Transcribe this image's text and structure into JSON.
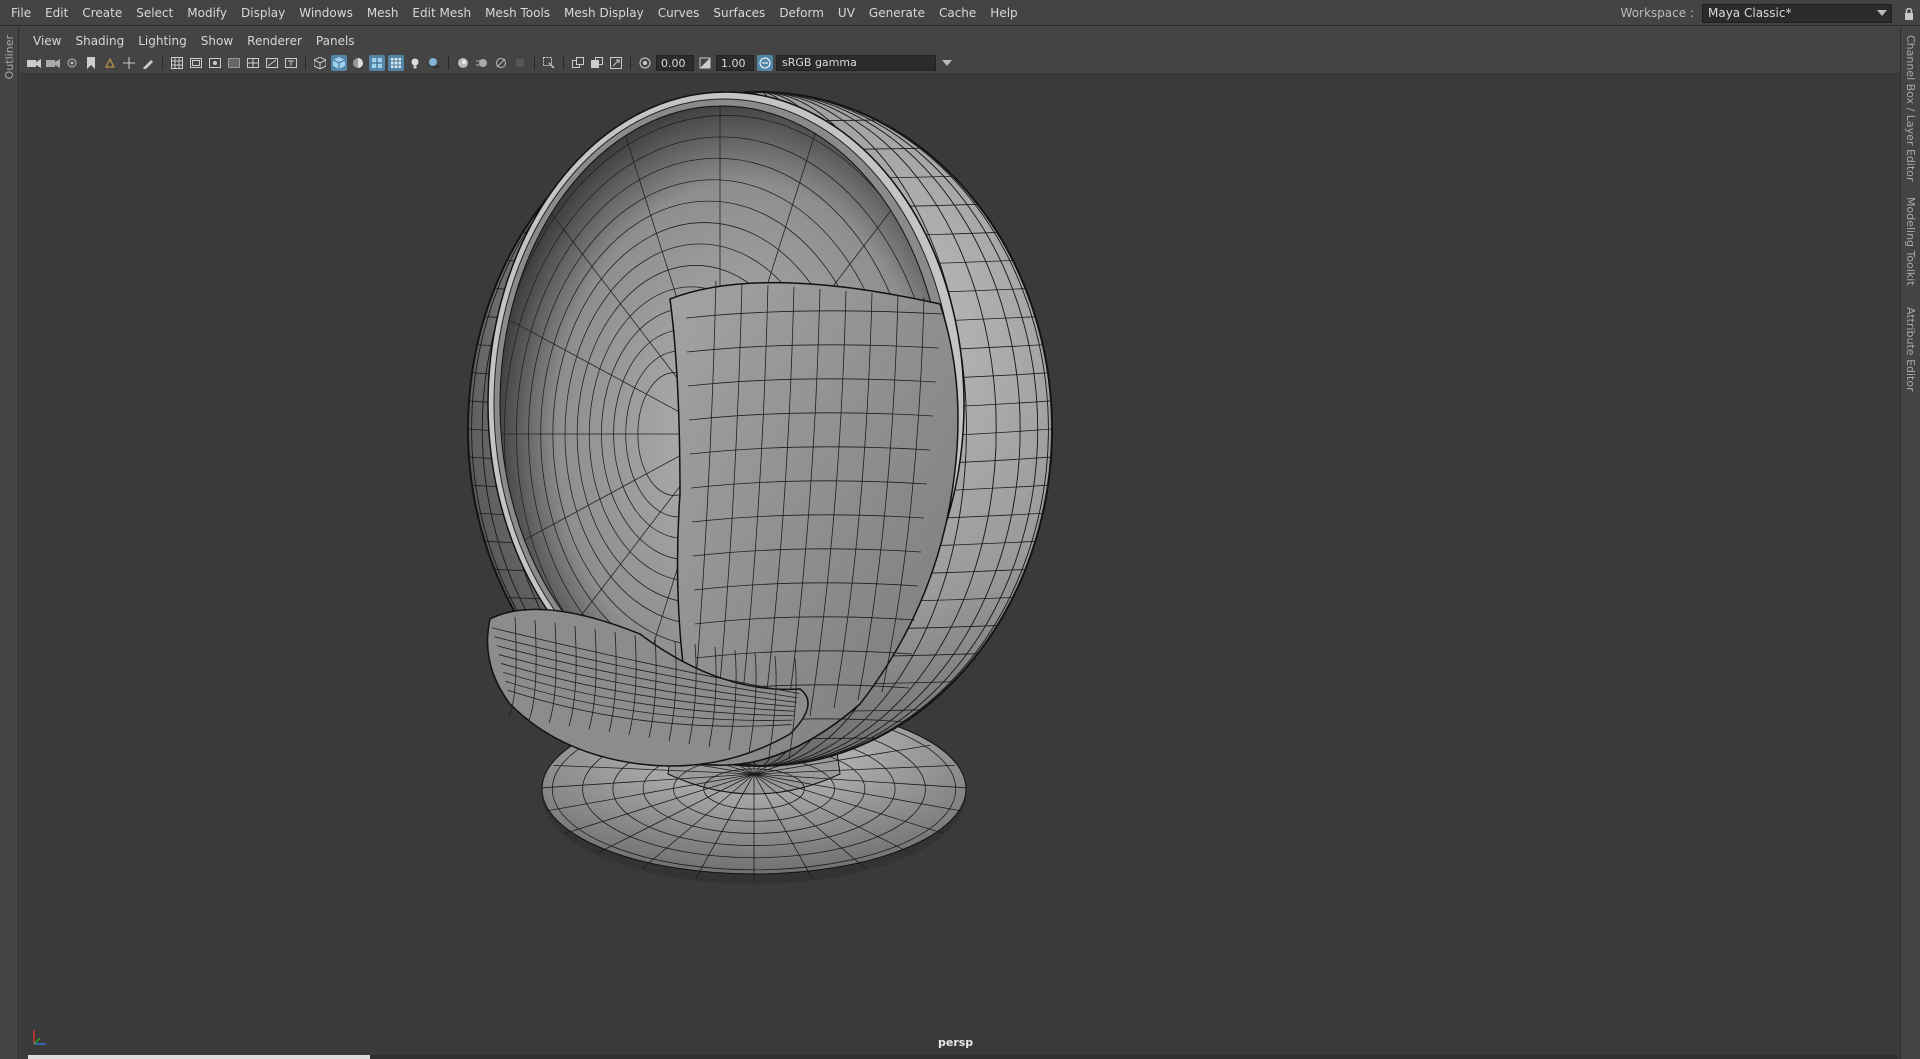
{
  "menubar": {
    "items": [
      "File",
      "Edit",
      "Create",
      "Select",
      "Modify",
      "Display",
      "Windows",
      "Mesh",
      "Edit Mesh",
      "Mesh Tools",
      "Mesh Display",
      "Curves",
      "Surfaces",
      "Deform",
      "UV",
      "Generate",
      "Cache",
      "Help"
    ]
  },
  "workspace": {
    "label": "Workspace :",
    "value": "Maya Classic*"
  },
  "left_tabs": {
    "outliner": "Outliner"
  },
  "right_tabs": {
    "channel_box": "Channel Box / Layer Editor",
    "modeling_toolkit": "Modeling Toolkit",
    "attribute_editor": "Attribute Editor"
  },
  "panel_menu": {
    "items": [
      "View",
      "Shading",
      "Lighting",
      "Show",
      "Renderer",
      "Panels"
    ]
  },
  "toolbar": {
    "exposure": "0.00",
    "gamma": "1.00",
    "color_space": "sRGB gamma"
  },
  "viewport": {
    "camera": "persp",
    "background": "#3a3a3a",
    "accent": "#5285a6"
  }
}
